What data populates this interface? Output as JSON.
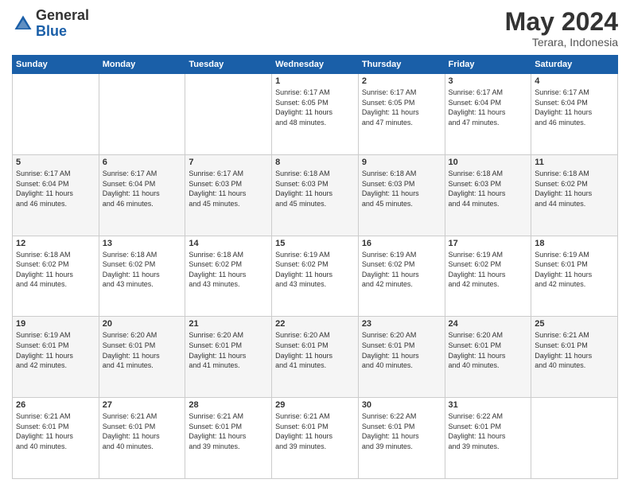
{
  "logo": {
    "general": "General",
    "blue": "Blue"
  },
  "header": {
    "month_year": "May 2024",
    "location": "Terara, Indonesia"
  },
  "days_of_week": [
    "Sunday",
    "Monday",
    "Tuesday",
    "Wednesday",
    "Thursday",
    "Friday",
    "Saturday"
  ],
  "weeks": [
    [
      {
        "day": "",
        "info": ""
      },
      {
        "day": "",
        "info": ""
      },
      {
        "day": "",
        "info": ""
      },
      {
        "day": "1",
        "info": "Sunrise: 6:17 AM\nSunset: 6:05 PM\nDaylight: 11 hours\nand 48 minutes."
      },
      {
        "day": "2",
        "info": "Sunrise: 6:17 AM\nSunset: 6:05 PM\nDaylight: 11 hours\nand 47 minutes."
      },
      {
        "day": "3",
        "info": "Sunrise: 6:17 AM\nSunset: 6:04 PM\nDaylight: 11 hours\nand 47 minutes."
      },
      {
        "day": "4",
        "info": "Sunrise: 6:17 AM\nSunset: 6:04 PM\nDaylight: 11 hours\nand 46 minutes."
      }
    ],
    [
      {
        "day": "5",
        "info": "Sunrise: 6:17 AM\nSunset: 6:04 PM\nDaylight: 11 hours\nand 46 minutes."
      },
      {
        "day": "6",
        "info": "Sunrise: 6:17 AM\nSunset: 6:04 PM\nDaylight: 11 hours\nand 46 minutes."
      },
      {
        "day": "7",
        "info": "Sunrise: 6:17 AM\nSunset: 6:03 PM\nDaylight: 11 hours\nand 45 minutes."
      },
      {
        "day": "8",
        "info": "Sunrise: 6:18 AM\nSunset: 6:03 PM\nDaylight: 11 hours\nand 45 minutes."
      },
      {
        "day": "9",
        "info": "Sunrise: 6:18 AM\nSunset: 6:03 PM\nDaylight: 11 hours\nand 45 minutes."
      },
      {
        "day": "10",
        "info": "Sunrise: 6:18 AM\nSunset: 6:03 PM\nDaylight: 11 hours\nand 44 minutes."
      },
      {
        "day": "11",
        "info": "Sunrise: 6:18 AM\nSunset: 6:02 PM\nDaylight: 11 hours\nand 44 minutes."
      }
    ],
    [
      {
        "day": "12",
        "info": "Sunrise: 6:18 AM\nSunset: 6:02 PM\nDaylight: 11 hours\nand 44 minutes."
      },
      {
        "day": "13",
        "info": "Sunrise: 6:18 AM\nSunset: 6:02 PM\nDaylight: 11 hours\nand 43 minutes."
      },
      {
        "day": "14",
        "info": "Sunrise: 6:18 AM\nSunset: 6:02 PM\nDaylight: 11 hours\nand 43 minutes."
      },
      {
        "day": "15",
        "info": "Sunrise: 6:19 AM\nSunset: 6:02 PM\nDaylight: 11 hours\nand 43 minutes."
      },
      {
        "day": "16",
        "info": "Sunrise: 6:19 AM\nSunset: 6:02 PM\nDaylight: 11 hours\nand 42 minutes."
      },
      {
        "day": "17",
        "info": "Sunrise: 6:19 AM\nSunset: 6:02 PM\nDaylight: 11 hours\nand 42 minutes."
      },
      {
        "day": "18",
        "info": "Sunrise: 6:19 AM\nSunset: 6:01 PM\nDaylight: 11 hours\nand 42 minutes."
      }
    ],
    [
      {
        "day": "19",
        "info": "Sunrise: 6:19 AM\nSunset: 6:01 PM\nDaylight: 11 hours\nand 42 minutes."
      },
      {
        "day": "20",
        "info": "Sunrise: 6:20 AM\nSunset: 6:01 PM\nDaylight: 11 hours\nand 41 minutes."
      },
      {
        "day": "21",
        "info": "Sunrise: 6:20 AM\nSunset: 6:01 PM\nDaylight: 11 hours\nand 41 minutes."
      },
      {
        "day": "22",
        "info": "Sunrise: 6:20 AM\nSunset: 6:01 PM\nDaylight: 11 hours\nand 41 minutes."
      },
      {
        "day": "23",
        "info": "Sunrise: 6:20 AM\nSunset: 6:01 PM\nDaylight: 11 hours\nand 40 minutes."
      },
      {
        "day": "24",
        "info": "Sunrise: 6:20 AM\nSunset: 6:01 PM\nDaylight: 11 hours\nand 40 minutes."
      },
      {
        "day": "25",
        "info": "Sunrise: 6:21 AM\nSunset: 6:01 PM\nDaylight: 11 hours\nand 40 minutes."
      }
    ],
    [
      {
        "day": "26",
        "info": "Sunrise: 6:21 AM\nSunset: 6:01 PM\nDaylight: 11 hours\nand 40 minutes."
      },
      {
        "day": "27",
        "info": "Sunrise: 6:21 AM\nSunset: 6:01 PM\nDaylight: 11 hours\nand 40 minutes."
      },
      {
        "day": "28",
        "info": "Sunrise: 6:21 AM\nSunset: 6:01 PM\nDaylight: 11 hours\nand 39 minutes."
      },
      {
        "day": "29",
        "info": "Sunrise: 6:21 AM\nSunset: 6:01 PM\nDaylight: 11 hours\nand 39 minutes."
      },
      {
        "day": "30",
        "info": "Sunrise: 6:22 AM\nSunset: 6:01 PM\nDaylight: 11 hours\nand 39 minutes."
      },
      {
        "day": "31",
        "info": "Sunrise: 6:22 AM\nSunset: 6:01 PM\nDaylight: 11 hours\nand 39 minutes."
      },
      {
        "day": "",
        "info": ""
      }
    ]
  ]
}
